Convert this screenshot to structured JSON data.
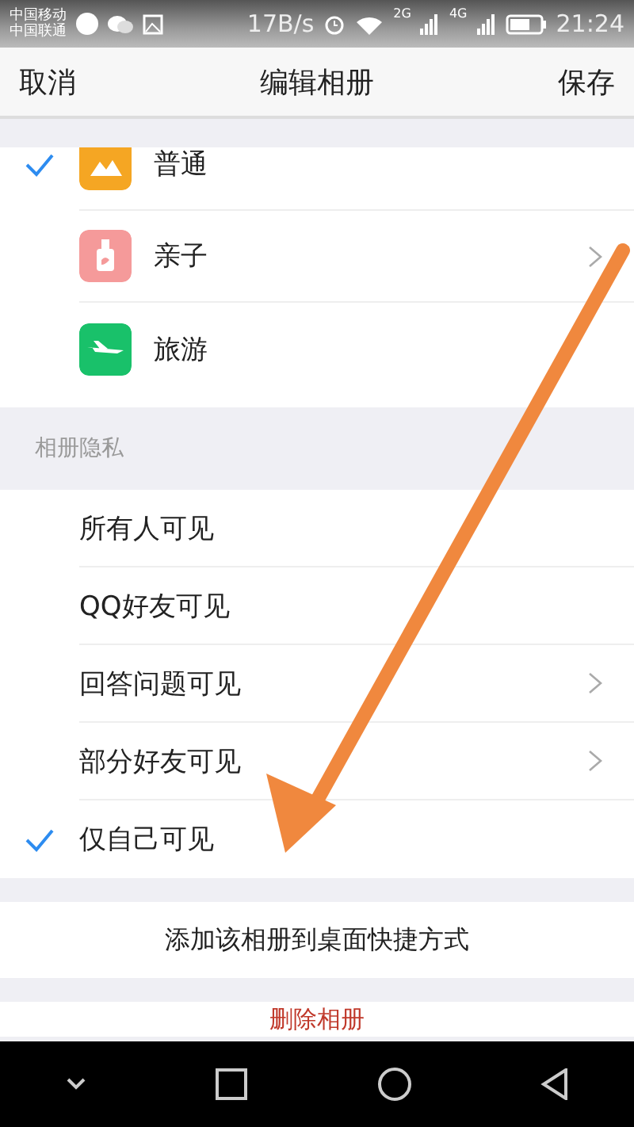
{
  "status_bar": {
    "carriers": [
      "中国移动",
      "中国联通"
    ],
    "speed": "17B/s",
    "networks": [
      "2G",
      "4G"
    ],
    "time": "21:24"
  },
  "header": {
    "cancel": "取消",
    "title": "编辑相册",
    "save": "保存"
  },
  "album_types": [
    {
      "label": "普通",
      "kind": "picture",
      "selected": true,
      "has_arrow": false
    },
    {
      "label": "亲子",
      "kind": "bottle",
      "selected": false,
      "has_arrow": true
    },
    {
      "label": "旅游",
      "kind": "plane",
      "selected": false,
      "has_arrow": false
    }
  ],
  "privacy": {
    "heading": "相册隐私",
    "options": [
      {
        "label": "所有人可见",
        "selected": false,
        "has_arrow": false
      },
      {
        "label": "QQ好友可见",
        "selected": false,
        "has_arrow": false
      },
      {
        "label": "回答问题可见",
        "selected": false,
        "has_arrow": true
      },
      {
        "label": "部分好友可见",
        "selected": false,
        "has_arrow": true
      },
      {
        "label": "仅自己可见",
        "selected": true,
        "has_arrow": false
      }
    ]
  },
  "actions": [
    {
      "label": "添加该相册到桌面快捷方式",
      "kind": "normal"
    },
    {
      "label": "删除相册",
      "kind": "danger"
    }
  ]
}
